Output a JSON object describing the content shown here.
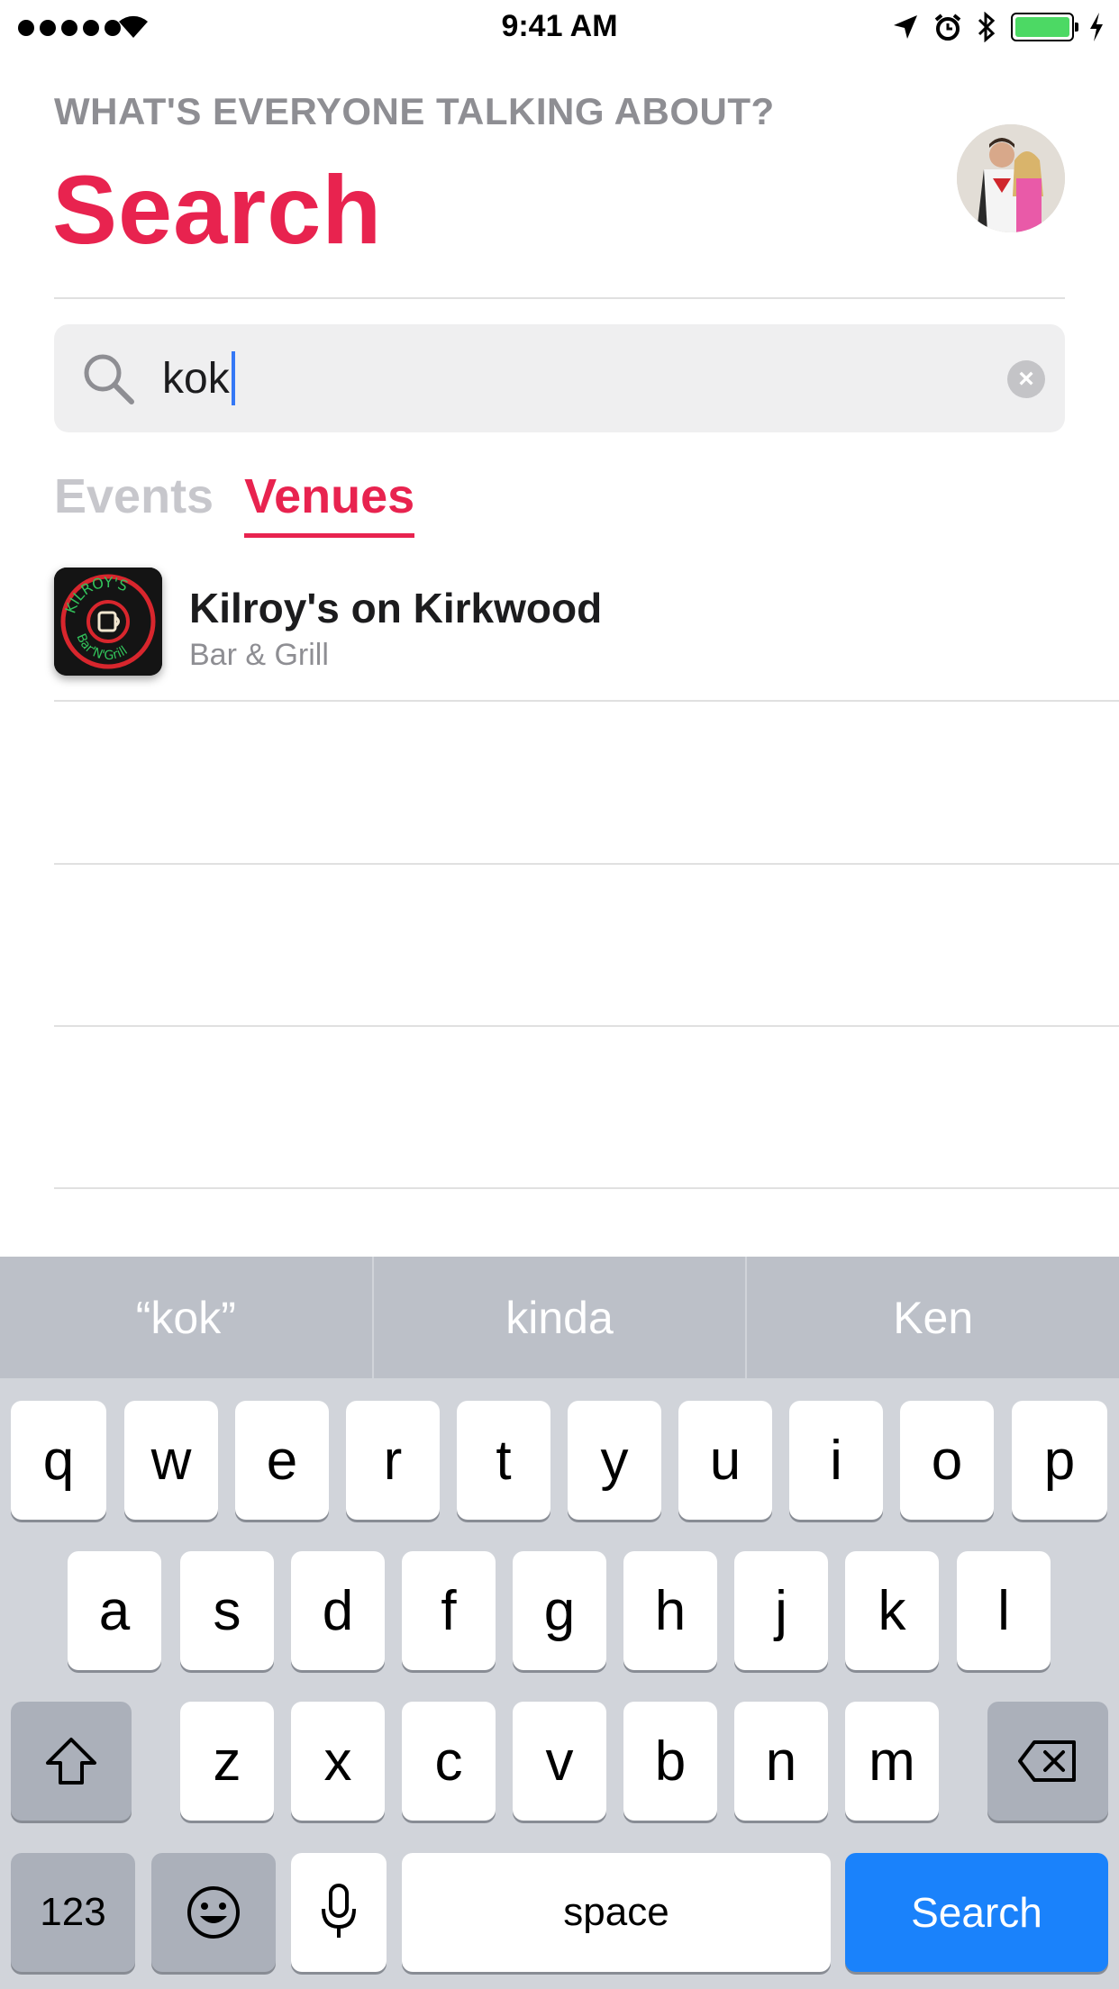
{
  "status_bar": {
    "time": "9:41 AM"
  },
  "header": {
    "eyebrow": "WHAT'S EVERYONE TALKING ABOUT?",
    "title": "Search"
  },
  "search": {
    "value": "kok"
  },
  "tabs": [
    {
      "label": "Events",
      "active": false
    },
    {
      "label": "Venues",
      "active": true
    }
  ],
  "results": [
    {
      "name": "Kilroy's on Kirkwood",
      "category": "Bar & Grill",
      "logo_text_top": "KILROY'S",
      "logo_text_bottom": "Bar'N'Grill"
    }
  ],
  "keyboard": {
    "suggestions": [
      "“kok”",
      "kinda",
      "Ken"
    ],
    "row1": [
      "q",
      "w",
      "e",
      "r",
      "t",
      "y",
      "u",
      "i",
      "o",
      "p"
    ],
    "row2": [
      "a",
      "s",
      "d",
      "f",
      "g",
      "h",
      "j",
      "k",
      "l"
    ],
    "row3": [
      "z",
      "x",
      "c",
      "v",
      "b",
      "n",
      "m"
    ],
    "numbers_label": "123",
    "space_label": "space",
    "return_label": "Search"
  },
  "colors": {
    "accent": "#e8234f",
    "return_key": "#1a82fb",
    "battery": "#4cd964"
  }
}
